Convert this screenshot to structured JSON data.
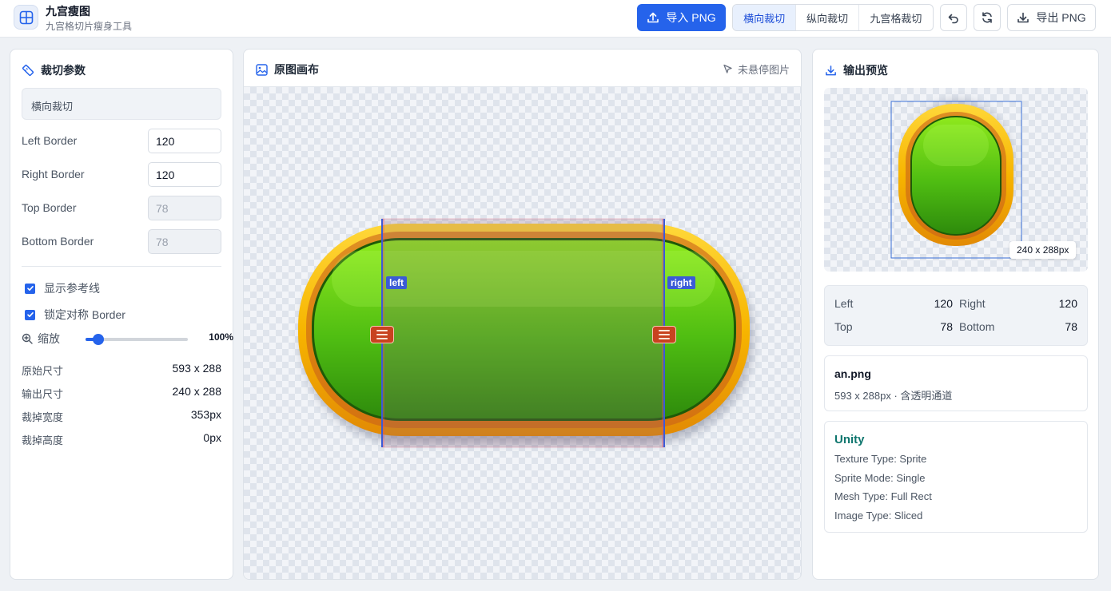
{
  "app": {
    "title": "九宫瘦图",
    "subtitle": "九宫格切片瘦身工具"
  },
  "toolbar": {
    "import_label": "导入 PNG",
    "modes": [
      "横向裁切",
      "纵向裁切",
      "九宫格裁切"
    ],
    "active_mode_index": 0,
    "export_label": "导出 PNG"
  },
  "colors": {
    "accent": "#2563eb",
    "guide": "#3b5bd6",
    "handle": "#c8431f",
    "unity_title": "#0f766e"
  },
  "left_panel": {
    "title": "裁切参数",
    "mode": "横向裁切",
    "fields": [
      {
        "label": "Left Border",
        "value": "120",
        "disabled": false
      },
      {
        "label": "Right Border",
        "value": "120",
        "disabled": false
      },
      {
        "label": "Top Border",
        "value": "78",
        "disabled": true
      },
      {
        "label": "Bottom Border",
        "value": "78",
        "disabled": true
      }
    ],
    "show_guides": {
      "label": "显示参考线",
      "checked": true
    },
    "lock_symmetric": {
      "label": "锁定对称 Border",
      "checked": true
    },
    "zoom": {
      "label": "缩放",
      "value_text": "100%",
      "fraction": 0.08
    },
    "stats": [
      {
        "label": "原始尺寸",
        "value": "593 x 288"
      },
      {
        "label": "输出尺寸",
        "value": "240 x 288"
      },
      {
        "label": "裁掉宽度",
        "value": "353px"
      },
      {
        "label": "裁掉高度",
        "value": "0px"
      }
    ]
  },
  "canvas_panel": {
    "title": "原图画布",
    "hover_status": "未悬停图片",
    "guide_left_label": "left",
    "guide_right_label": "right"
  },
  "right_panel": {
    "title": "输出预览",
    "preview_size_badge": "240 x 288px",
    "borders": {
      "left_label": "Left",
      "left_value": "120",
      "right_label": "Right",
      "right_value": "120",
      "top_label": "Top",
      "top_value": "78",
      "bottom_label": "Bottom",
      "bottom_value": "78"
    },
    "file": {
      "name": "an.png",
      "info": "593 x 288px · 含透明通道"
    },
    "unity": {
      "title": "Unity",
      "lines": [
        "Texture Type: Sprite",
        "Sprite Mode: Single",
        "Mesh Type: Full Rect",
        "Image Type: Sliced"
      ]
    }
  }
}
